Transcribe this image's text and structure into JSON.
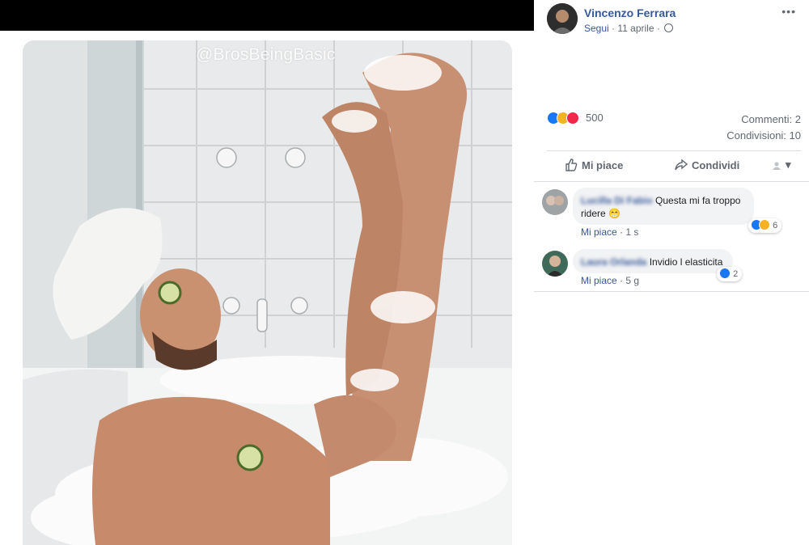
{
  "photo": {
    "watermark": "@BrosBeingBasic",
    "description": "man-in-bubble-bath-photo"
  },
  "post": {
    "author_name": "Vincenzo Ferrara",
    "follow_label": "Segui",
    "meta_separator": " · ",
    "date": "11 aprile",
    "more_icon": "more-options-icon",
    "more_label": "•••"
  },
  "stats": {
    "reactions_count": "500",
    "reaction_types": [
      "like",
      "haha",
      "love"
    ],
    "comments_label": "Commenti: 2",
    "shares_label": "Condivisioni: 10"
  },
  "actions": {
    "like_label": "Mi piace",
    "share_label": "Condividi",
    "picker_label": "▾"
  },
  "comments": [
    {
      "name": "Lucilla Di Fabio",
      "text": "Questa mi fa troppo ridere 😁",
      "like_label": "Mi piace",
      "time": "1 s",
      "reactions_count": "6"
    },
    {
      "name": "Laura Orlanda",
      "text": "Invidio l elasticita",
      "like_label": "Mi piace",
      "time": "5 g",
      "reactions_count": "2"
    }
  ],
  "colors": {
    "link": "#385898",
    "text_secondary": "#606770",
    "like_blue": "#1877f2",
    "haha_yellow": "#f7b125",
    "love_red": "#f0284a",
    "bubble_bg": "#f2f3f5"
  }
}
